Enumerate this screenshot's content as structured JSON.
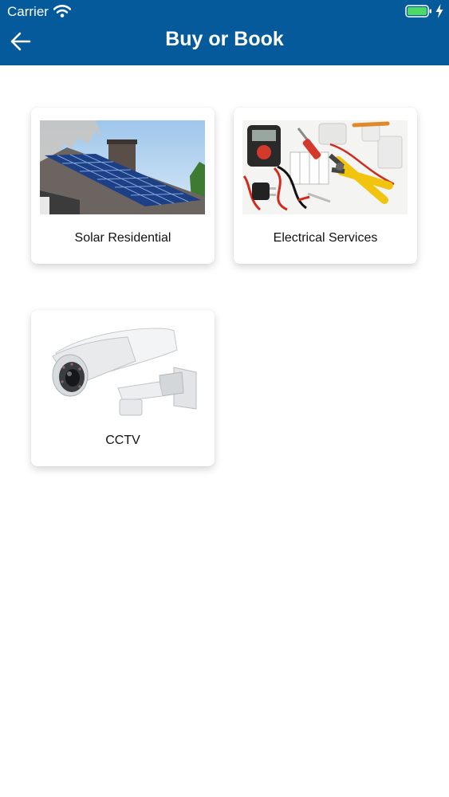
{
  "status_bar": {
    "carrier": "Carrier",
    "battery_color": "#4cd964"
  },
  "nav": {
    "title": "Buy or Book",
    "back_icon": "arrow-left-icon",
    "background_color": "#055a9b"
  },
  "categories": [
    {
      "label": "Solar Residential",
      "image": "solar-panel-roof-image"
    },
    {
      "label": "Electrical Services",
      "image": "electrical-tools-image"
    },
    {
      "label": "CCTV",
      "image": "cctv-camera-image"
    }
  ]
}
